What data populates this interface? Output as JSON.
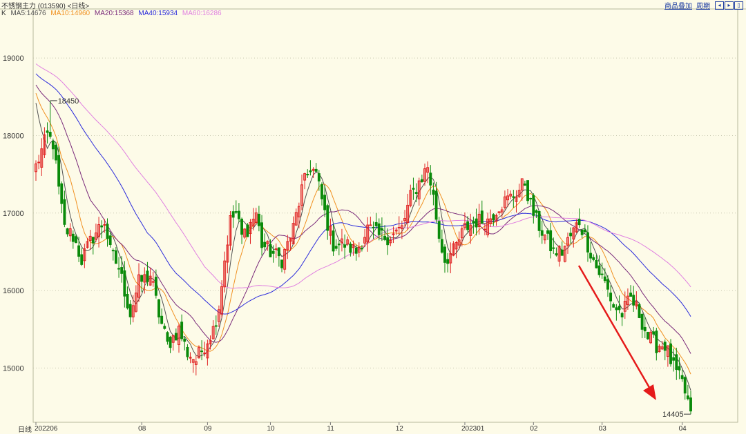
{
  "header": {
    "title": "不锈钢主力 (013590) <日线>",
    "compare_label": "商品叠加",
    "period_label": "周期",
    "nav_icons": [
      "arrow-left-icon",
      "arrow-right-icon",
      "zoom-in-icon"
    ]
  },
  "legend": {
    "k_label": "K",
    "ma5": "MA5:14676",
    "ma10": "MA10:14960",
    "ma20": "MA20:15368",
    "ma40": "MA40:15934",
    "ma60": "MA60:16286"
  },
  "colors": {
    "up": "#e02020",
    "down": "#0a8a0a",
    "ma5": "#505050",
    "ma10": "#f09020",
    "ma20": "#7a2a7a",
    "ma40": "#2a2adb",
    "ma60": "#e080e0",
    "annotation_arrow": "#e51a1a",
    "background": "#fdfbe8"
  },
  "chart_data": {
    "type": "candlestick",
    "title": "不锈钢主力 (013590)",
    "period": "日线",
    "ylim": [
      14300,
      19500
    ],
    "y_ticks": [
      15000,
      16000,
      17000,
      18000,
      19000
    ],
    "x_tick_labels": [
      "202206",
      "08",
      "09",
      "10",
      "11",
      "12",
      "202301",
      "02",
      "03",
      "04"
    ],
    "x_tick_index": [
      0,
      37,
      60,
      82,
      103,
      127,
      150,
      174,
      198,
      226
    ],
    "n_bars": 230,
    "annotations": {
      "high_label": "18450",
      "high_value": 18450,
      "high_index": 5,
      "low_label": "14405",
      "low_value": 14405,
      "low_index": 229
    },
    "close_anchors": [
      [
        0,
        17600
      ],
      [
        4,
        18000
      ],
      [
        6,
        17900
      ],
      [
        8,
        17300
      ],
      [
        10,
        16800
      ],
      [
        13,
        16700
      ],
      [
        16,
        16400
      ],
      [
        20,
        16700
      ],
      [
        24,
        16900
      ],
      [
        26,
        16500
      ],
      [
        29,
        16300
      ],
      [
        33,
        15700
      ],
      [
        36,
        16100
      ],
      [
        40,
        16200
      ],
      [
        43,
        15700
      ],
      [
        46,
        15300
      ],
      [
        50,
        15500
      ],
      [
        53,
        15200
      ],
      [
        56,
        15100
      ],
      [
        59,
        15300
      ],
      [
        62,
        15500
      ],
      [
        64,
        15800
      ],
      [
        66,
        16400
      ],
      [
        68,
        16900
      ],
      [
        70,
        17000
      ],
      [
        72,
        16700
      ],
      [
        74,
        16800
      ],
      [
        77,
        17000
      ],
      [
        79,
        16600
      ],
      [
        82,
        16500
      ],
      [
        86,
        16400
      ],
      [
        90,
        16800
      ],
      [
        93,
        17300
      ],
      [
        96,
        17600
      ],
      [
        98,
        17500
      ],
      [
        101,
        17000
      ],
      [
        104,
        16600
      ],
      [
        108,
        16600
      ],
      [
        112,
        16500
      ],
      [
        116,
        16800
      ],
      [
        120,
        16700
      ],
      [
        124,
        16700
      ],
      [
        128,
        16800
      ],
      [
        131,
        17200
      ],
      [
        134,
        17400
      ],
      [
        137,
        17600
      ],
      [
        139,
        17200
      ],
      [
        141,
        16700
      ],
      [
        143,
        16400
      ],
      [
        146,
        16500
      ],
      [
        150,
        16800
      ],
      [
        154,
        16900
      ],
      [
        158,
        16900
      ],
      [
        162,
        17100
      ],
      [
        166,
        17200
      ],
      [
        169,
        17300
      ],
      [
        171,
        17400
      ],
      [
        173,
        17100
      ],
      [
        175,
        16900
      ],
      [
        178,
        16700
      ],
      [
        181,
        16500
      ],
      [
        184,
        16500
      ],
      [
        187,
        16700
      ],
      [
        190,
        16900
      ],
      [
        193,
        16600
      ],
      [
        196,
        16300
      ],
      [
        199,
        16100
      ],
      [
        202,
        15800
      ],
      [
        205,
        15700
      ],
      [
        208,
        15900
      ],
      [
        211,
        15700
      ],
      [
        214,
        15400
      ],
      [
        217,
        15300
      ],
      [
        220,
        15300
      ],
      [
        223,
        15000
      ],
      [
        226,
        14800
      ],
      [
        229,
        14450
      ]
    ],
    "moving_averages": [
      {
        "name": "MA5",
        "period": 5,
        "last": 14676
      },
      {
        "name": "MA10",
        "period": 10,
        "last": 14960
      },
      {
        "name": "MA20",
        "period": 20,
        "last": 15368
      },
      {
        "name": "MA40",
        "period": 40,
        "last": 15934
      },
      {
        "name": "MA60",
        "period": 60,
        "last": 16286
      }
    ],
    "grid": true
  }
}
